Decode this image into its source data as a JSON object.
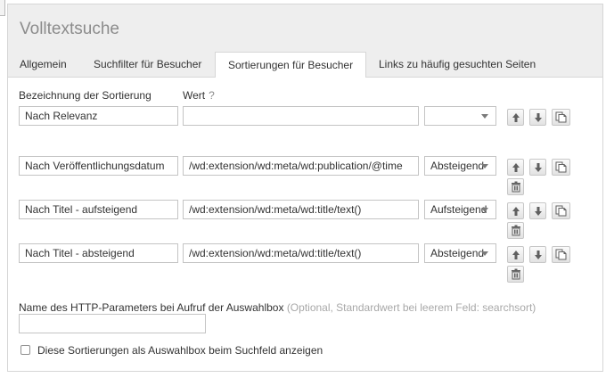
{
  "panel": {
    "title": "Volltextsuche"
  },
  "tabs": [
    {
      "label": "Allgemein",
      "active": false
    },
    {
      "label": "Suchfilter für Besucher",
      "active": false
    },
    {
      "label": "Sortierungen für Besucher",
      "active": true
    },
    {
      "label": "Links zu häufig gesuchten Seiten",
      "active": false
    }
  ],
  "columns": {
    "name": "Bezeichnung der Sortierung",
    "value": "Wert",
    "value_help": "?"
  },
  "rows": [
    {
      "name": "Nach Relevanz",
      "value": "",
      "order": "",
      "can_delete": false
    },
    {
      "name": "Nach Veröffentlichungsdatum",
      "value": "/wd:extension/wd:meta/wd:publication/@time",
      "order": "Absteigend",
      "can_delete": true
    },
    {
      "name": "Nach Titel - aufsteigend",
      "value": "/wd:extension/wd:meta/wd:title/text()",
      "order": "Aufsteigend",
      "can_delete": true
    },
    {
      "name": "Nach Titel - absteigend",
      "value": "/wd:extension/wd:meta/wd:title/text()",
      "order": "Absteigend",
      "can_delete": true
    }
  ],
  "icons": {
    "up": "arrow-up-icon",
    "down": "arrow-down-icon",
    "copy": "copy-icon",
    "delete": "trash-icon"
  },
  "http_param": {
    "label": "Name des HTTP-Parameters bei Aufruf der Auswahlbox",
    "hint": "(Optional, Standardwert bei leerem Feld: searchsort)",
    "value": ""
  },
  "show_selectbox": {
    "label": "Diese Sortierungen als Auswahlbox beim Suchfeld anzeigen",
    "checked": false
  },
  "colors": {
    "header_bg": "#eeeeee",
    "border": "#d6d6d6",
    "title": "#8c8c8c",
    "hint": "#a8a8a8"
  }
}
